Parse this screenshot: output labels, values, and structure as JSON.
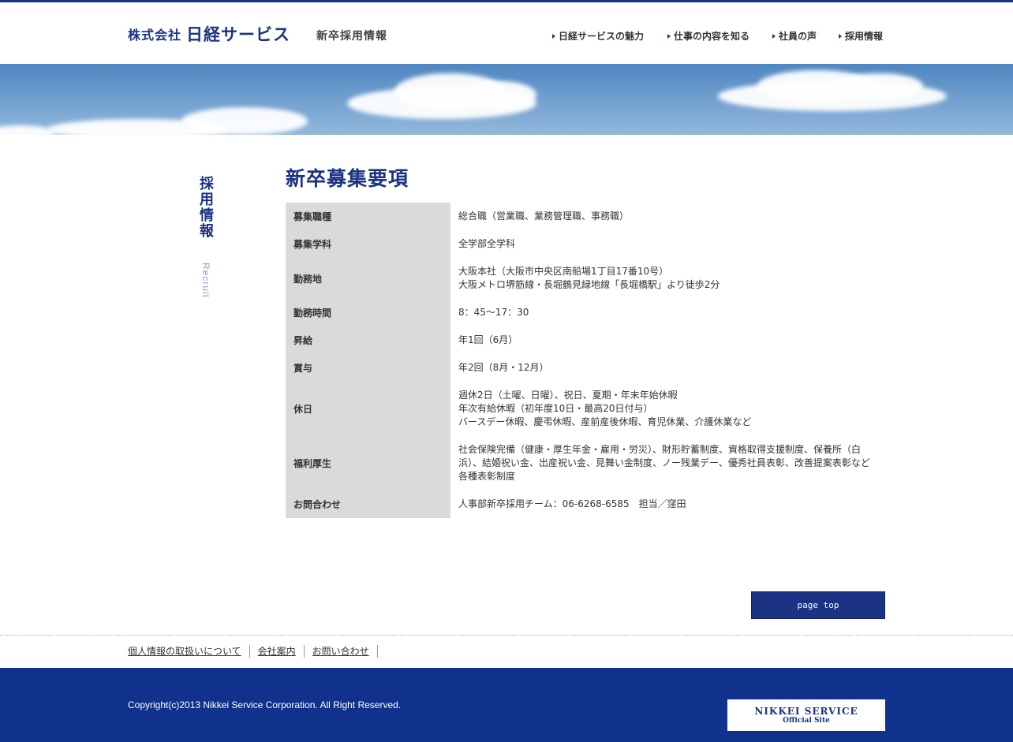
{
  "header": {
    "logo_prefix": "株式会社",
    "logo_main": "日経サービス",
    "site_subtitle": "新卒採用情報"
  },
  "nav": [
    {
      "label": "日経サービスの魅力"
    },
    {
      "label": "仕事の内容を知る"
    },
    {
      "label": "社員の声"
    },
    {
      "label": "採用情報"
    }
  ],
  "side": {
    "title_ja": "採用情報",
    "title_en": "Recruit"
  },
  "main": {
    "title": "新卒募集要項",
    "rows": [
      {
        "label": "募集職種",
        "value": "総合職（営業職、業務管理職、事務職）"
      },
      {
        "label": "募集学科",
        "value": "全学部全学科"
      },
      {
        "label": "勤務地",
        "value": "大阪本社（大阪市中央区南船場1丁目17番10号）\n大阪メトロ堺筋線・長堀鶴見緑地線「長堀橋駅」より徒歩2分"
      },
      {
        "label": "勤務時間",
        "value": "8：45～17：30"
      },
      {
        "label": "昇給",
        "value": "年1回（6月）"
      },
      {
        "label": "賞与",
        "value": "年2回（8月・12月）"
      },
      {
        "label": "休日",
        "value": "週休2日（土曜、日曜）、祝日、夏期・年末年始休暇\n年次有給休暇（初年度10日・最高20日付与）\nバースデー休暇、慶弔休暇、産前産後休暇、育児休業、介護休業など"
      },
      {
        "label": "福利厚生",
        "value": "社会保険完備（健康・厚生年金・雇用・労災）、財形貯蓄制度、資格取得支援制度、保養所（白浜）、結婚祝い金、出産祝い金、見舞い金制度、ノー残業デー、優秀社員表彰、改善提案表彰など各種表彰制度"
      },
      {
        "label": "お問合わせ",
        "value": "人事部新卒採用チーム：06-6268-6585　担当／窪田"
      }
    ]
  },
  "pagetop_label": "page top",
  "footer": {
    "links": [
      "個人情報の取扱いについて",
      "会社案内",
      "お問い合わせ"
    ],
    "copyright": "Copyright(c)2013 Nikkei Service Corporation. All Right Reserved.",
    "official_line1": "NIKKEI SERVICE",
    "official_line2": "Official Site"
  },
  "colors": {
    "brand": "#1a3384",
    "footer_bg": "#11328c",
    "table_header_bg": "#dadada"
  }
}
